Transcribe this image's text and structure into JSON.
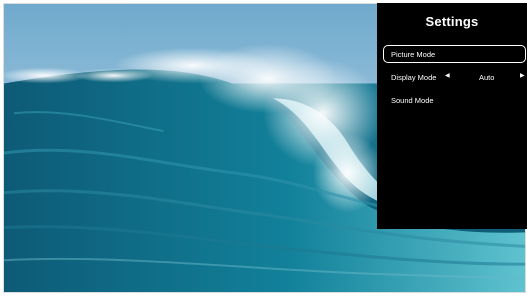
{
  "background": {
    "image": "ocean wave",
    "sky_color": "#a9cde3",
    "water_color": "#0f6f8c"
  },
  "settings_panel": {
    "title": "Settings",
    "items": [
      {
        "label": "Picture Mode",
        "selected": true
      },
      {
        "label": "Display Mode",
        "value": "Auto",
        "left_arrow": "◀",
        "right_arrow": "▶"
      },
      {
        "label": "Sound Mode"
      }
    ]
  }
}
